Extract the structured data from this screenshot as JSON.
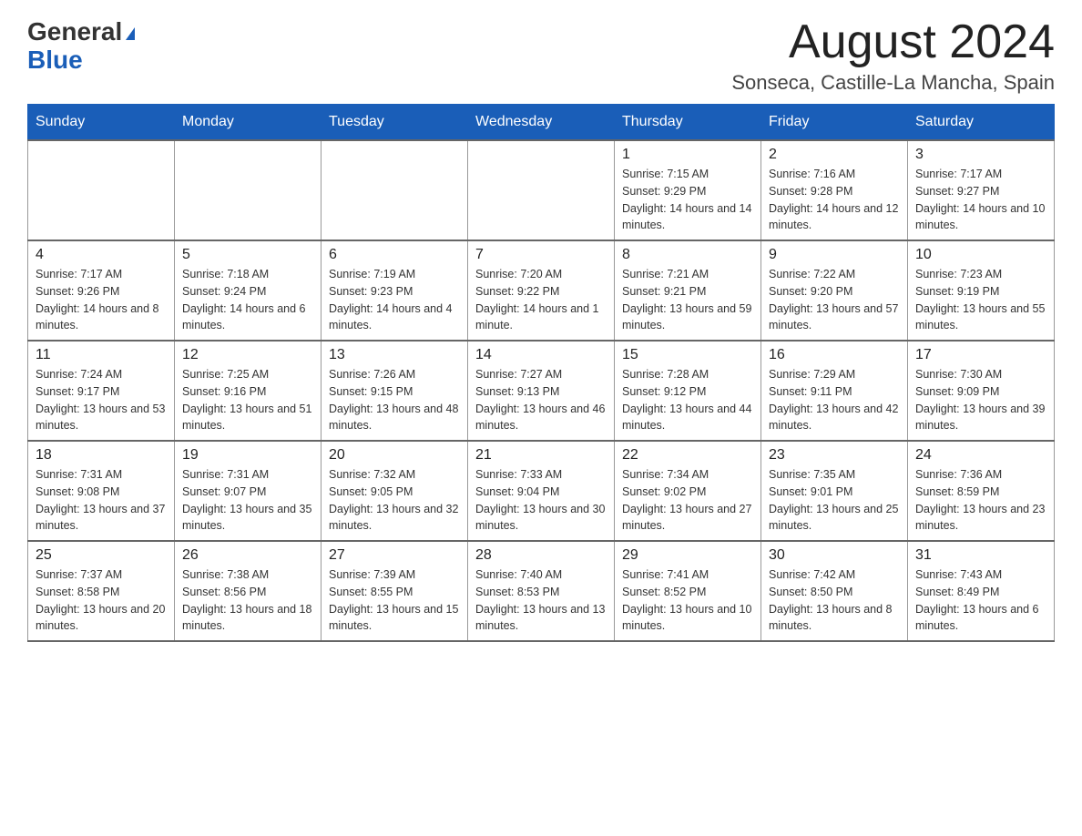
{
  "logo": {
    "general": "General",
    "blue": "Blue"
  },
  "title": "August 2024",
  "location": "Sonseca, Castille-La Mancha, Spain",
  "days_of_week": [
    "Sunday",
    "Monday",
    "Tuesday",
    "Wednesday",
    "Thursday",
    "Friday",
    "Saturday"
  ],
  "weeks": [
    [
      {
        "day": "",
        "info": ""
      },
      {
        "day": "",
        "info": ""
      },
      {
        "day": "",
        "info": ""
      },
      {
        "day": "",
        "info": ""
      },
      {
        "day": "1",
        "info": "Sunrise: 7:15 AM\nSunset: 9:29 PM\nDaylight: 14 hours and 14 minutes."
      },
      {
        "day": "2",
        "info": "Sunrise: 7:16 AM\nSunset: 9:28 PM\nDaylight: 14 hours and 12 minutes."
      },
      {
        "day": "3",
        "info": "Sunrise: 7:17 AM\nSunset: 9:27 PM\nDaylight: 14 hours and 10 minutes."
      }
    ],
    [
      {
        "day": "4",
        "info": "Sunrise: 7:17 AM\nSunset: 9:26 PM\nDaylight: 14 hours and 8 minutes."
      },
      {
        "day": "5",
        "info": "Sunrise: 7:18 AM\nSunset: 9:24 PM\nDaylight: 14 hours and 6 minutes."
      },
      {
        "day": "6",
        "info": "Sunrise: 7:19 AM\nSunset: 9:23 PM\nDaylight: 14 hours and 4 minutes."
      },
      {
        "day": "7",
        "info": "Sunrise: 7:20 AM\nSunset: 9:22 PM\nDaylight: 14 hours and 1 minute."
      },
      {
        "day": "8",
        "info": "Sunrise: 7:21 AM\nSunset: 9:21 PM\nDaylight: 13 hours and 59 minutes."
      },
      {
        "day": "9",
        "info": "Sunrise: 7:22 AM\nSunset: 9:20 PM\nDaylight: 13 hours and 57 minutes."
      },
      {
        "day": "10",
        "info": "Sunrise: 7:23 AM\nSunset: 9:19 PM\nDaylight: 13 hours and 55 minutes."
      }
    ],
    [
      {
        "day": "11",
        "info": "Sunrise: 7:24 AM\nSunset: 9:17 PM\nDaylight: 13 hours and 53 minutes."
      },
      {
        "day": "12",
        "info": "Sunrise: 7:25 AM\nSunset: 9:16 PM\nDaylight: 13 hours and 51 minutes."
      },
      {
        "day": "13",
        "info": "Sunrise: 7:26 AM\nSunset: 9:15 PM\nDaylight: 13 hours and 48 minutes."
      },
      {
        "day": "14",
        "info": "Sunrise: 7:27 AM\nSunset: 9:13 PM\nDaylight: 13 hours and 46 minutes."
      },
      {
        "day": "15",
        "info": "Sunrise: 7:28 AM\nSunset: 9:12 PM\nDaylight: 13 hours and 44 minutes."
      },
      {
        "day": "16",
        "info": "Sunrise: 7:29 AM\nSunset: 9:11 PM\nDaylight: 13 hours and 42 minutes."
      },
      {
        "day": "17",
        "info": "Sunrise: 7:30 AM\nSunset: 9:09 PM\nDaylight: 13 hours and 39 minutes."
      }
    ],
    [
      {
        "day": "18",
        "info": "Sunrise: 7:31 AM\nSunset: 9:08 PM\nDaylight: 13 hours and 37 minutes."
      },
      {
        "day": "19",
        "info": "Sunrise: 7:31 AM\nSunset: 9:07 PM\nDaylight: 13 hours and 35 minutes."
      },
      {
        "day": "20",
        "info": "Sunrise: 7:32 AM\nSunset: 9:05 PM\nDaylight: 13 hours and 32 minutes."
      },
      {
        "day": "21",
        "info": "Sunrise: 7:33 AM\nSunset: 9:04 PM\nDaylight: 13 hours and 30 minutes."
      },
      {
        "day": "22",
        "info": "Sunrise: 7:34 AM\nSunset: 9:02 PM\nDaylight: 13 hours and 27 minutes."
      },
      {
        "day": "23",
        "info": "Sunrise: 7:35 AM\nSunset: 9:01 PM\nDaylight: 13 hours and 25 minutes."
      },
      {
        "day": "24",
        "info": "Sunrise: 7:36 AM\nSunset: 8:59 PM\nDaylight: 13 hours and 23 minutes."
      }
    ],
    [
      {
        "day": "25",
        "info": "Sunrise: 7:37 AM\nSunset: 8:58 PM\nDaylight: 13 hours and 20 minutes."
      },
      {
        "day": "26",
        "info": "Sunrise: 7:38 AM\nSunset: 8:56 PM\nDaylight: 13 hours and 18 minutes."
      },
      {
        "day": "27",
        "info": "Sunrise: 7:39 AM\nSunset: 8:55 PM\nDaylight: 13 hours and 15 minutes."
      },
      {
        "day": "28",
        "info": "Sunrise: 7:40 AM\nSunset: 8:53 PM\nDaylight: 13 hours and 13 minutes."
      },
      {
        "day": "29",
        "info": "Sunrise: 7:41 AM\nSunset: 8:52 PM\nDaylight: 13 hours and 10 minutes."
      },
      {
        "day": "30",
        "info": "Sunrise: 7:42 AM\nSunset: 8:50 PM\nDaylight: 13 hours and 8 minutes."
      },
      {
        "day": "31",
        "info": "Sunrise: 7:43 AM\nSunset: 8:49 PM\nDaylight: 13 hours and 6 minutes."
      }
    ]
  ]
}
